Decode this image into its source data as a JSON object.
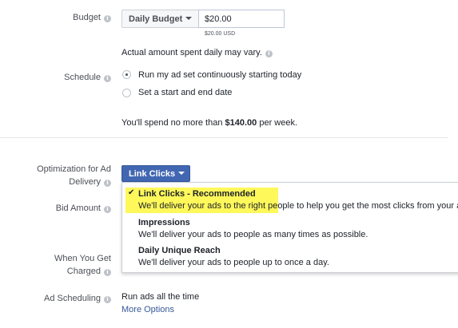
{
  "budget": {
    "label": "Budget",
    "type_value": "Daily Budget",
    "amount_value": "$20.00",
    "amount_currency_note": "$20.00 USD",
    "note": "Actual amount spent daily may vary."
  },
  "schedule": {
    "label": "Schedule",
    "options": [
      {
        "label": "Run my ad set continuously starting today",
        "selected": true
      },
      {
        "label": "Set a start and end date",
        "selected": false
      }
    ],
    "spend_prefix": "You'll spend no more than ",
    "spend_amount": "$140.00",
    "spend_suffix": " per week."
  },
  "optimization": {
    "label_line1": "Optimization for Ad",
    "label_line2": "Delivery",
    "button_label": "Link Clicks",
    "menu": [
      {
        "title": "Link Clicks - Recommended",
        "description": "We'll deliver your ads to the right people to help you get the most clicks from your ad",
        "selected": true
      },
      {
        "title": "Impressions",
        "description": "We'll deliver your ads to people as many times as possible.",
        "selected": false
      },
      {
        "title": "Daily Unique Reach",
        "description": "We'll deliver your ads to people up to once a day.",
        "selected": false
      }
    ]
  },
  "bid_amount": {
    "label": "Bid Amount"
  },
  "when_charged": {
    "label_line1": "When You Get",
    "label_line2": "Charged"
  },
  "ad_scheduling": {
    "label": "Ad Scheduling",
    "value": "Run ads all the time",
    "more_options": "More Options"
  },
  "colors": {
    "primary_button": "#4267b2",
    "highlight": "#fef85a",
    "link": "#365899"
  },
  "icons": [
    "info-icon",
    "caret-down-icon",
    "checkmark-icon",
    "radio-icon"
  ]
}
